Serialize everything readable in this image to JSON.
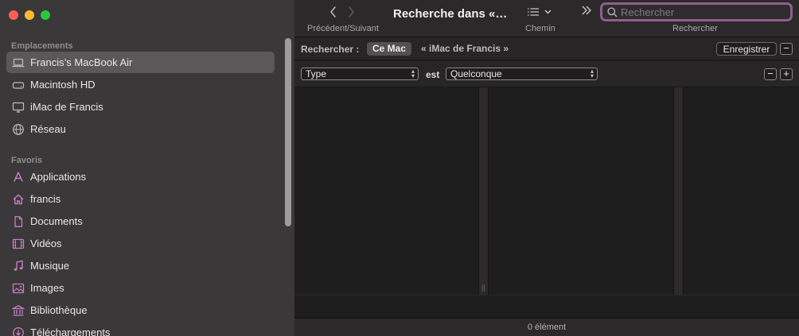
{
  "sidebar": {
    "sections": [
      {
        "title": "Emplacements",
        "items": [
          {
            "label": "Francis’s MacBook Air",
            "icon": "laptop-icon",
            "selected": true
          },
          {
            "label": "Macintosh HD",
            "icon": "harddrive-icon"
          },
          {
            "label": "iMac de Francis",
            "icon": "desktop-icon"
          },
          {
            "label": "Réseau",
            "icon": "globe-icon"
          }
        ]
      },
      {
        "title": "Favoris",
        "items": [
          {
            "label": "Applications",
            "icon": "applications-icon"
          },
          {
            "label": "francis",
            "icon": "home-icon"
          },
          {
            "label": "Documents",
            "icon": "document-icon"
          },
          {
            "label": "Vidéos",
            "icon": "film-icon"
          },
          {
            "label": "Musique",
            "icon": "music-icon"
          },
          {
            "label": "Images",
            "icon": "photo-icon"
          },
          {
            "label": "Bibliothèque",
            "icon": "library-icon"
          },
          {
            "label": "Téléchargements",
            "icon": "download-icon"
          }
        ]
      }
    ]
  },
  "toolbar": {
    "title": "Recherche dans «…",
    "nav_label": "Précédent/Suivant",
    "path_label": "Chemin",
    "search_label": "Rechercher",
    "search_placeholder": "Rechercher"
  },
  "scope": {
    "label": "Rechercher :",
    "options": [
      "Ce Mac",
      "« iMac de Francis »"
    ],
    "save_label": "Enregistrer",
    "remove": "−"
  },
  "criteria": {
    "attribute": "Type",
    "operator": "est",
    "value": "Quelconque",
    "remove": "−",
    "add": "+"
  },
  "status": {
    "text": "0 élément"
  },
  "colors": {
    "accent_focus": "#8e5f8e",
    "icon_tint": "#c77ec3"
  }
}
